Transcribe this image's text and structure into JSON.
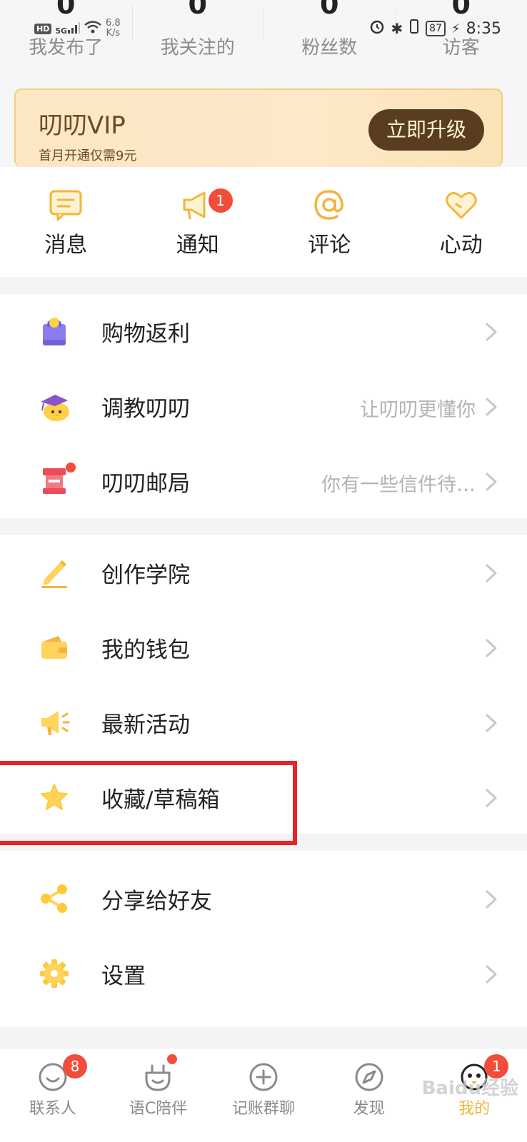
{
  "status_bar": {
    "hd": "HD",
    "signal": "5G",
    "net_speed": "6.8",
    "net_unit": "K/s",
    "battery": "87",
    "time": "8:35"
  },
  "stats": [
    {
      "count": "0",
      "label": "我发布了"
    },
    {
      "count": "0",
      "label": "我关注的"
    },
    {
      "count": "0",
      "label": "粉丝数"
    },
    {
      "count": "0",
      "label": "访客"
    }
  ],
  "vip": {
    "title": "叨叨VIP",
    "subtitle": "首月开通仅需9元",
    "button": "立即升级"
  },
  "quick_actions": [
    {
      "label": "消息",
      "icon": "message-icon"
    },
    {
      "label": "通知",
      "icon": "megaphone-icon",
      "badge": "1"
    },
    {
      "label": "评论",
      "icon": "at-icon"
    },
    {
      "label": "心动",
      "icon": "heart-icon"
    }
  ],
  "group1": [
    {
      "label": "购物返利",
      "icon": "shopping-bag-icon",
      "hint": ""
    },
    {
      "label": "调教叨叨",
      "icon": "chick-mascot-icon",
      "hint": "让叨叨更懂你"
    },
    {
      "label": "叨叨邮局",
      "icon": "mailbox-icon",
      "hint": "你有一些信件待…"
    }
  ],
  "group2": [
    {
      "label": "创作学院",
      "icon": "pencil-icon"
    },
    {
      "label": "我的钱包",
      "icon": "wallet-icon"
    },
    {
      "label": "最新活动",
      "icon": "megaphone-icon"
    },
    {
      "label": "收藏/草稿箱",
      "icon": "star-icon"
    }
  ],
  "group3": [
    {
      "label": "分享给好友",
      "icon": "share-icon"
    },
    {
      "label": "设置",
      "icon": "gear-icon"
    }
  ],
  "tabs": [
    {
      "label": "联系人",
      "icon": "contacts-icon",
      "badge": "8"
    },
    {
      "label": "语C陪伴",
      "icon": "companion-icon"
    },
    {
      "label": "记账群聊",
      "icon": "plus-circle-icon"
    },
    {
      "label": "发现",
      "icon": "compass-icon"
    },
    {
      "label": "我的",
      "icon": "profile-mascot-icon",
      "badge": "1",
      "active": true
    }
  ],
  "watermark": "Baidu经验",
  "colors": {
    "accent": "#f0b43a",
    "badge": "#f24d3a",
    "vip_button": "#5a3d20",
    "highlight": "#e8232a"
  }
}
